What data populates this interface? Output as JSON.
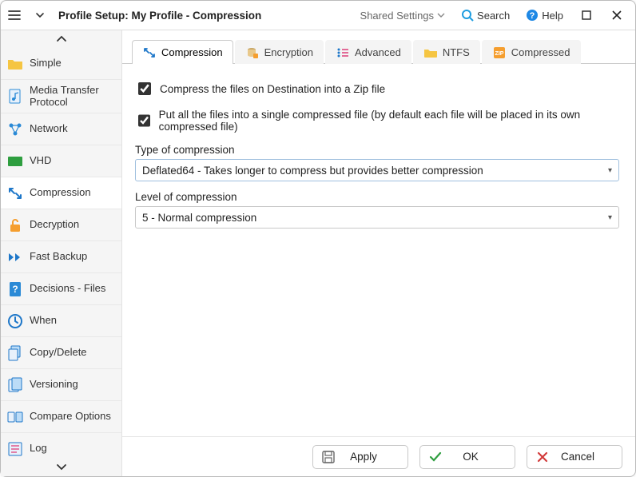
{
  "title": "Profile Setup: My Profile - Compression",
  "header": {
    "shared_settings": "Shared Settings",
    "search": "Search",
    "help": "Help"
  },
  "sidebar": {
    "items": [
      {
        "label": "Simple"
      },
      {
        "label": "Media Transfer Protocol"
      },
      {
        "label": "Network"
      },
      {
        "label": "VHD"
      },
      {
        "label": "Compression"
      },
      {
        "label": "Decryption"
      },
      {
        "label": "Fast Backup"
      },
      {
        "label": "Decisions - Files"
      },
      {
        "label": "When"
      },
      {
        "label": "Copy/Delete"
      },
      {
        "label": "Versioning"
      },
      {
        "label": "Compare Options"
      },
      {
        "label": "Log"
      }
    ]
  },
  "tabs": [
    {
      "label": "Compression"
    },
    {
      "label": "Encryption"
    },
    {
      "label": "Advanced"
    },
    {
      "label": "NTFS"
    },
    {
      "label": "Compressed"
    }
  ],
  "form": {
    "checkbox1": "Compress the files on Destination into a Zip file",
    "checkbox2": "Put all the files into a single compressed file (by default each file will be placed in its own compressed file)",
    "type_label": "Type of compression",
    "type_value": "Deflated64 - Takes longer to compress but provides better compression",
    "level_label": "Level of compression",
    "level_value": "5 - Normal compression"
  },
  "buttons": {
    "apply": "Apply",
    "ok": "OK",
    "cancel": "Cancel"
  }
}
